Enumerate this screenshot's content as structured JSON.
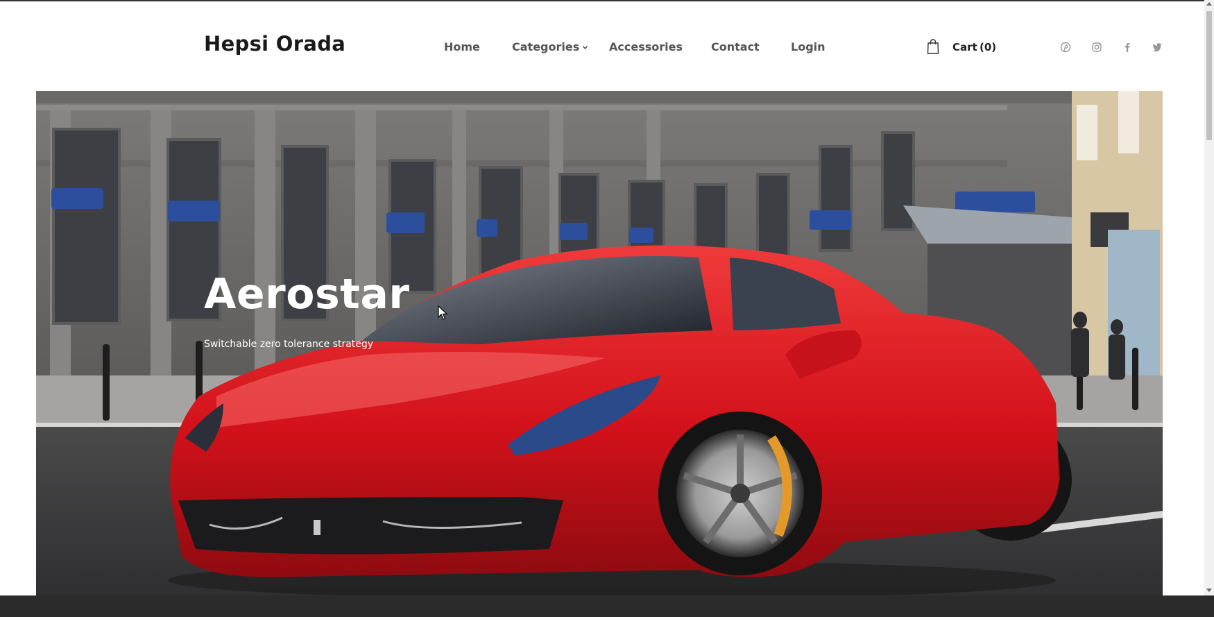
{
  "site": {
    "logo": "Hepsi Orada"
  },
  "nav": {
    "items": [
      {
        "label": "Home"
      },
      {
        "label": "Categories"
      },
      {
        "label": "Accessories"
      },
      {
        "label": "Contact"
      },
      {
        "label": "Login"
      }
    ]
  },
  "cart": {
    "label": "Cart",
    "count": "(0)",
    "icon": "shopping-bag-icon"
  },
  "social": [
    "pinterest-icon",
    "instagram-icon",
    "facebook-icon",
    "twitter-icon"
  ],
  "hero": {
    "title": "Aerostar",
    "subtitle": "Switchable zero tolerance strategy"
  },
  "colors": {
    "car_red": "#d8151c",
    "text_dark": "#1a1a1a",
    "nav_text": "#555555",
    "bottom_bar": "#2b2b2b"
  }
}
